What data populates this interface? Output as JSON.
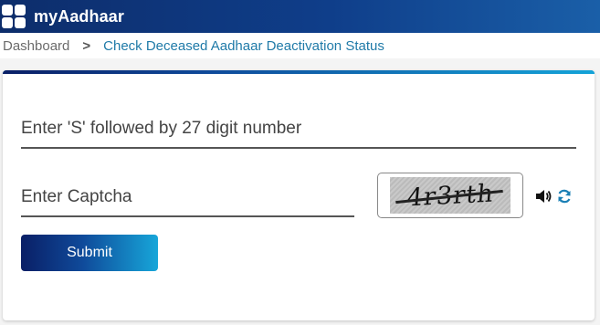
{
  "app": {
    "title": "myAadhaar",
    "logo_icon": "grid-icon"
  },
  "breadcrumb": {
    "home": "Dashboard",
    "separator": ">",
    "current": "Check Deceased Aadhaar Deactivation Status"
  },
  "form": {
    "sid_placeholder": "Enter 'S' followed by 27 digit number",
    "sid_value": "",
    "captcha_placeholder": "Enter Captcha",
    "captcha_value": "",
    "captcha_image_text": "4r3rth",
    "audio_icon": "speaker-icon",
    "refresh_icon": "refresh-icon",
    "submit_label": "Submit"
  },
  "colors": {
    "header": "#0f3e8a",
    "accent": "#1495cf",
    "link": "#1f7aa8"
  }
}
